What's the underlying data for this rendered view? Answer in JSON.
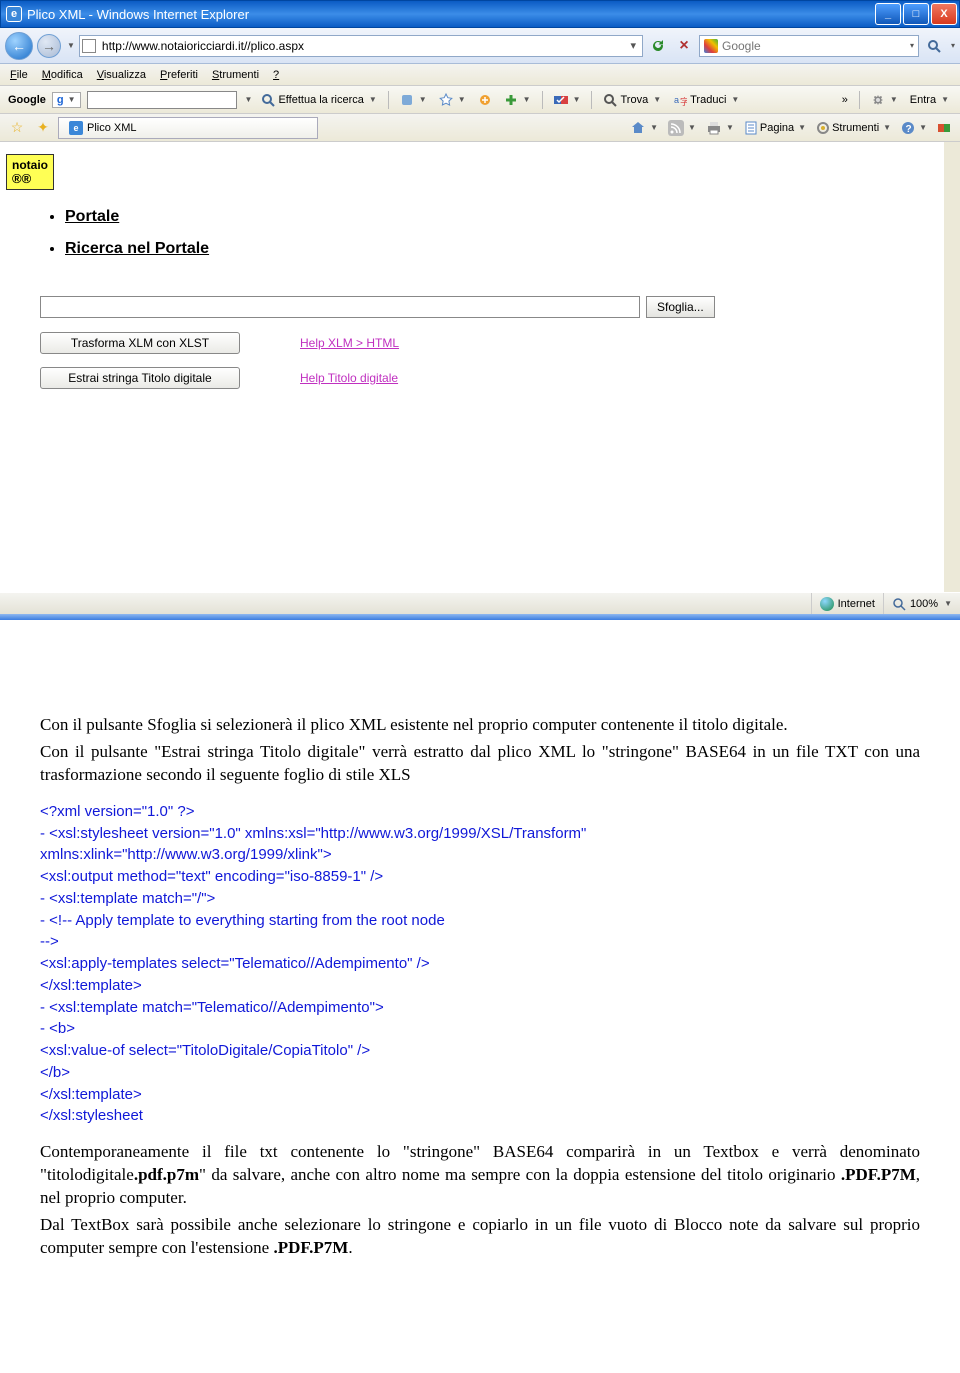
{
  "titlebar": {
    "title": "Plico XML - Windows Internet Explorer"
  },
  "winbtns": {
    "min": "_",
    "max": "□",
    "close": "X"
  },
  "nav": {
    "back": "←",
    "fwd": "→",
    "url": "http://www.notaioricciardi.it//plico.aspx",
    "refresh": "↻",
    "stop": "×",
    "search_placeholder": "Google",
    "mag": "🔍"
  },
  "menu": [
    "File",
    "Modifica",
    "Visualizza",
    "Preferiti",
    "Strumenti",
    "?"
  ],
  "gtb": {
    "label": "Google",
    "g": "g",
    "effettua": "Effettua la ricerca",
    "trova": "Trova",
    "traduci": "Traduci",
    "entra": "Entra"
  },
  "tabbar": {
    "tab": "Plico XML",
    "pagina": "Pagina",
    "strumenti": "Strumenti"
  },
  "page": {
    "logo1": "notaio",
    "logo2": "®®",
    "link1": "Portale",
    "link2": "Ricerca nel Portale",
    "browse": "Sfoglia...",
    "btn1": "Trasforma XLM con XLST",
    "help1": "Help XLM > HTML",
    "btn2": "Estrai stringa Titolo digitale",
    "help2": "Help Titolo digitale"
  },
  "status": {
    "zone": "Internet",
    "zoom": "100%"
  },
  "doc": {
    "p1": "Con il pulsante Sfoglia si selezionerà il plico XML esistente nel proprio computer contenente il titolo digitale.",
    "p2": "Con il pulsante \"Estrai stringa Titolo digitale\" verrà estratto dal plico XML lo \"stringone\" BASE64 in un  file TXT  con una trasformazione secondo il seguente foglio di stile XLS",
    "code": [
      "  <?xml version=\"1.0\" ?>",
      "- <xsl:stylesheet version=\"1.0\" xmlns:xsl=\"http://www.w3.org/1999/XSL/Transform\"",
      "   xmlns:xlink=\"http://www.w3.org/1999/xlink\">",
      "  <xsl:output method=\"text\" encoding=\"iso-8859-1\" />",
      "- <xsl:template match=\"/\">",
      "- <!-- Apply template to everything starting from the root node",
      "  -->",
      "  <xsl:apply-templates select=\"Telematico//Adempimento\" />",
      "  </xsl:template>",
      "- <xsl:template match=\"Telematico//Adempimento\">",
      "- <b>",
      "  <xsl:value-of select=\"TitoloDigitale/CopiaTitolo\" />",
      "  </b>",
      "  </xsl:template>",
      "  </xsl:stylesheet"
    ],
    "p3a": "Contemporaneamente il file txt contenente lo \"stringone\" BASE64 comparirà in un Textbox e verrà denominato \"titolodigitale",
    "p3b": ".pdf.p7m",
    "p3c": "\" da salvare, anche con altro nome ma sempre con la doppia estensione del titolo originario ",
    "p3d": ".PDF.P7M",
    "p3e": ", nel proprio computer.",
    "p4a": "Dal TextBox sarà possibile anche selezionare lo stringone e copiarlo in un file vuoto di Blocco note da salvare sul proprio computer sempre con l'estensione ",
    "p4b": ".PDF.P7M",
    "p4c": "."
  }
}
